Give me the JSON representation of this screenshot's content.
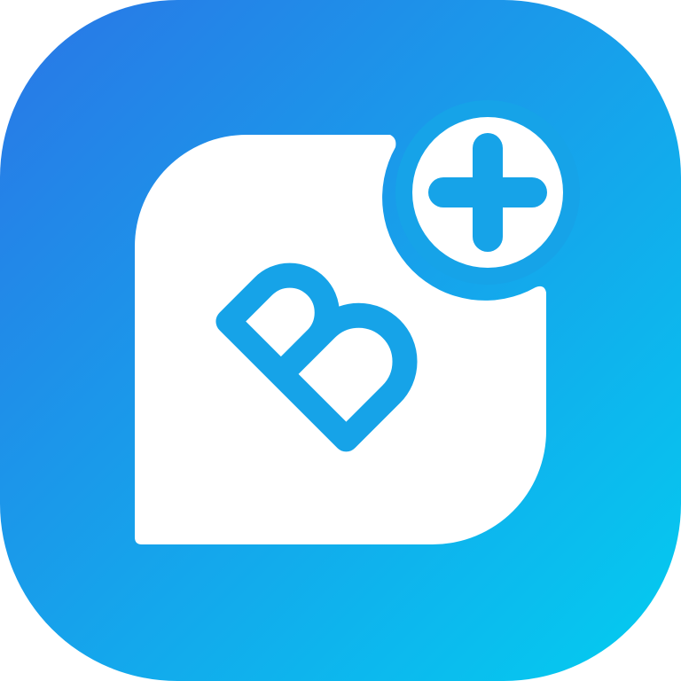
{
  "app_icon": {
    "logo_text": "B",
    "badge_symbol": "plus",
    "icon_names": [
      "app-logo-icon",
      "plus-badge-icon"
    ],
    "colors": {
      "gradient_start": "#2A76E6",
      "gradient_end": "#03CDF0",
      "glyph": "#16A3E8",
      "tile": "#FFFFFF"
    }
  }
}
